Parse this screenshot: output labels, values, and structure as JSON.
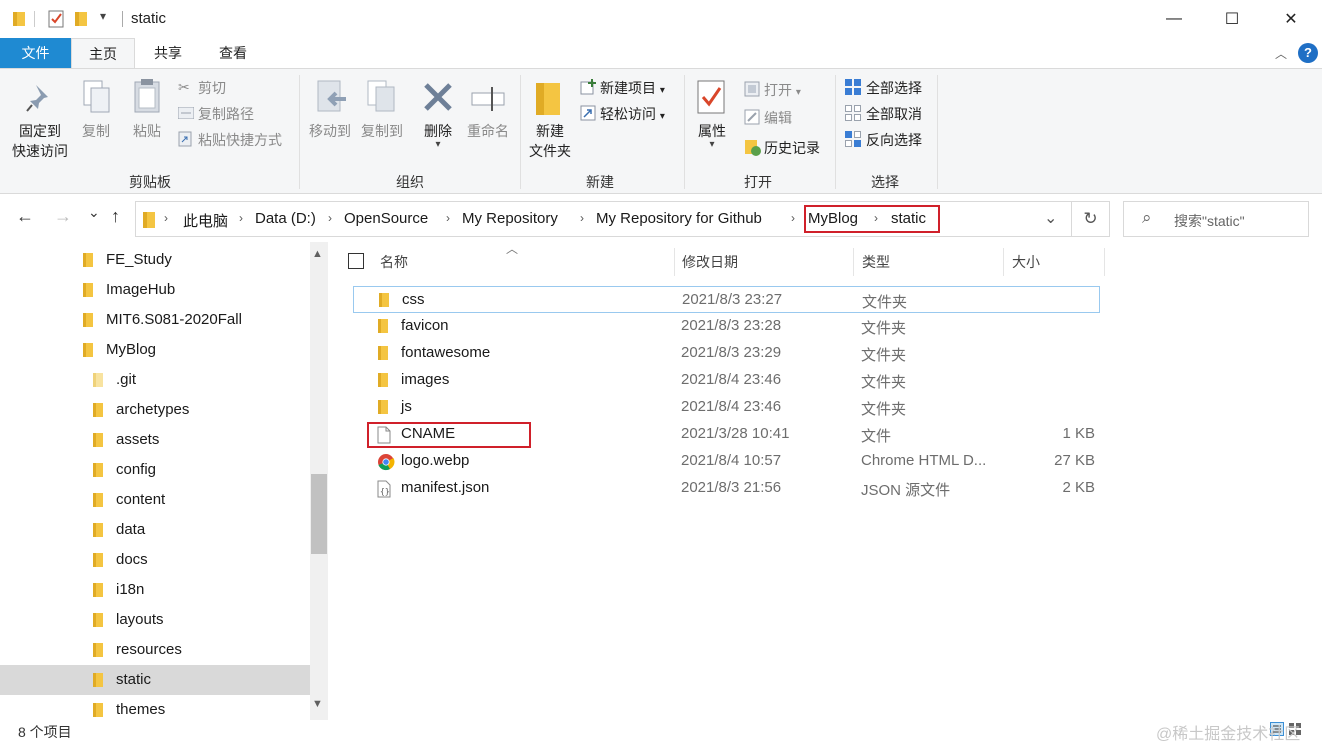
{
  "window": {
    "title": "static",
    "minimize_glyph": "—",
    "maximize_glyph": "☐",
    "close_glyph": "✕",
    "qa_dropdown_glyph": "▾"
  },
  "ribbon_tabs": {
    "file": "文件",
    "home": "主页",
    "share": "共享",
    "view": "查看",
    "collapse_glyph": "︿",
    "help_glyph": "?"
  },
  "ribbon": {
    "clipboard": {
      "label": "剪贴板",
      "pin_line1": "固定到",
      "pin_line2": "快速访问",
      "copy": "复制",
      "paste": "粘贴",
      "cut": "剪切",
      "copy_path": "复制路径",
      "paste_shortcut": "粘贴快捷方式"
    },
    "organize": {
      "label": "组织",
      "move_to": "移动到",
      "copy_to": "复制到",
      "delete": "删除",
      "rename": "重命名",
      "dropdown_glyph": "▾"
    },
    "new": {
      "label": "新建",
      "new_folder_line1": "新建",
      "new_folder_line2": "文件夹",
      "new_item": "新建项目",
      "easy_access": "轻松访问",
      "dropdown_glyph": "▾"
    },
    "open": {
      "label": "打开",
      "properties": "属性",
      "open": "打开",
      "edit": "编辑",
      "history": "历史记录",
      "dropdown_glyph": "▾"
    },
    "select": {
      "label": "选择",
      "select_all": "全部选择",
      "select_none": "全部取消",
      "invert": "反向选择"
    }
  },
  "nav": {
    "back_glyph": "←",
    "forward_glyph": "→",
    "recent_glyph": "⌄",
    "up_glyph": "↑",
    "refresh_glyph": "↻",
    "expand_glyph": "⌄",
    "crumb_sep": "›",
    "breadcrumb": [
      "此电脑",
      "Data (D:)",
      "OpenSource",
      "My Repository",
      "My Repository for Github",
      "MyBlog",
      "static"
    ],
    "search_placeholder": "搜索\"static\"",
    "search_glyph": "⌕"
  },
  "tree": {
    "scroll_up_glyph": "▲",
    "scroll_down_glyph": "▼",
    "items": [
      {
        "label": "FE_Study",
        "level": 0
      },
      {
        "label": "ImageHub",
        "level": 0
      },
      {
        "label": "MIT6.S081-2020Fall",
        "level": 0
      },
      {
        "label": "MyBlog",
        "level": 0
      },
      {
        "label": ".git",
        "level": 1
      },
      {
        "label": "archetypes",
        "level": 1
      },
      {
        "label": "assets",
        "level": 1
      },
      {
        "label": "config",
        "level": 1
      },
      {
        "label": "content",
        "level": 1
      },
      {
        "label": "data",
        "level": 1
      },
      {
        "label": "docs",
        "level": 1
      },
      {
        "label": "i18n",
        "level": 1
      },
      {
        "label": "layouts",
        "level": 1
      },
      {
        "label": "resources",
        "level": 1
      },
      {
        "label": "static",
        "level": 1,
        "selected": true
      },
      {
        "label": "themes",
        "level": 1
      }
    ]
  },
  "filelist": {
    "sort_glyph": "︿",
    "columns": {
      "name": "名称",
      "date": "修改日期",
      "type": "类型",
      "size": "大小"
    },
    "rows": [
      {
        "name": "css",
        "date": "2021/8/3 23:27",
        "type": "文件夹",
        "size": "",
        "icon": "folder-icon"
      },
      {
        "name": "favicon",
        "date": "2021/8/3 23:28",
        "type": "文件夹",
        "size": "",
        "icon": "folder-icon"
      },
      {
        "name": "fontawesome",
        "date": "2021/8/3 23:29",
        "type": "文件夹",
        "size": "",
        "icon": "folder-icon"
      },
      {
        "name": "images",
        "date": "2021/8/4 23:46",
        "type": "文件夹",
        "size": "",
        "icon": "folder-icon"
      },
      {
        "name": "js",
        "date": "2021/8/4 23:46",
        "type": "文件夹",
        "size": "",
        "icon": "folder-icon"
      },
      {
        "name": "CNAME",
        "date": "2021/3/28 10:41",
        "type": "文件",
        "size": "1 KB",
        "icon": "file-icon"
      },
      {
        "name": "logo.webp",
        "date": "2021/8/4 10:57",
        "type": "Chrome HTML D...",
        "size": "27 KB",
        "icon": "chrome-icon"
      },
      {
        "name": "manifest.json",
        "date": "2021/8/3 21:56",
        "type": "JSON 源文件",
        "size": "2 KB",
        "icon": "json-file-icon"
      }
    ]
  },
  "status": {
    "item_count": "8 个项目",
    "watermark": "@稀土掘金技术社区"
  },
  "colors": {
    "file_tab": "#1f8ad2",
    "highlight_box": "#d0202a",
    "folder": "#f4c542",
    "selected_row": "#d9d9d9"
  }
}
